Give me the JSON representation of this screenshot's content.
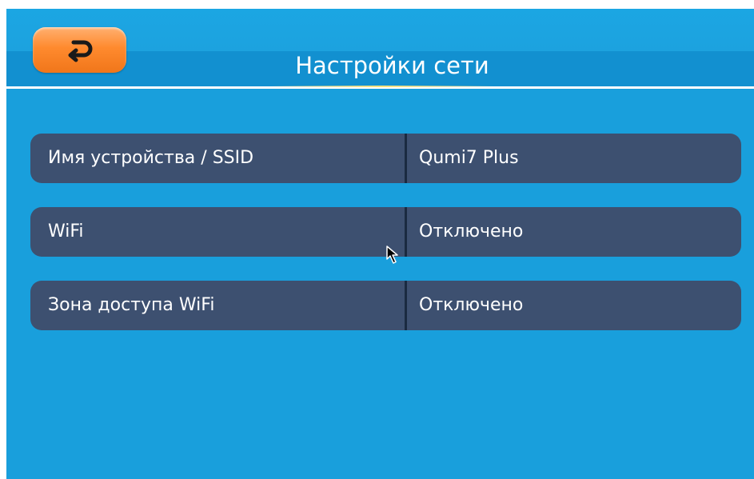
{
  "header": {
    "title": "Настройки сети",
    "back_icon": "return-arrow-icon"
  },
  "settings": [
    {
      "label": "Имя устройства / SSID",
      "value": "Qumi7 Plus"
    },
    {
      "label": "WiFi",
      "value": "Отключено"
    },
    {
      "label": "Зона доступа WiFi",
      "value": "Отключено"
    }
  ],
  "colors": {
    "background": "#1aa3e0",
    "header_band": "#1290d0",
    "row_background": "#3d5070",
    "back_button": "#ff8a2e",
    "text": "#ffffff"
  }
}
